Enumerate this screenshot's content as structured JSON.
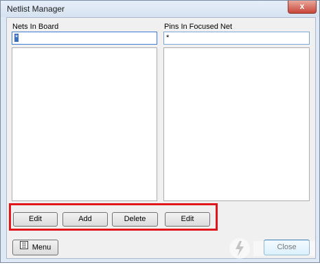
{
  "window": {
    "title": "Netlist Manager",
    "close_glyph": "x"
  },
  "nets": {
    "label": "Nets In Board",
    "filter_value": "*"
  },
  "pins": {
    "label": "Pins In Focused Net",
    "filter_value": "*"
  },
  "buttons": {
    "edit1": "Edit",
    "add": "Add",
    "delete": "Delete",
    "edit2": "Edit"
  },
  "footer": {
    "menu": "Menu",
    "close": "Close"
  },
  "colors": {
    "highlight": "#e0161b",
    "focus": "#3a7bd5"
  },
  "icons": {
    "menu": "menu-icon",
    "close": "close-icon"
  }
}
